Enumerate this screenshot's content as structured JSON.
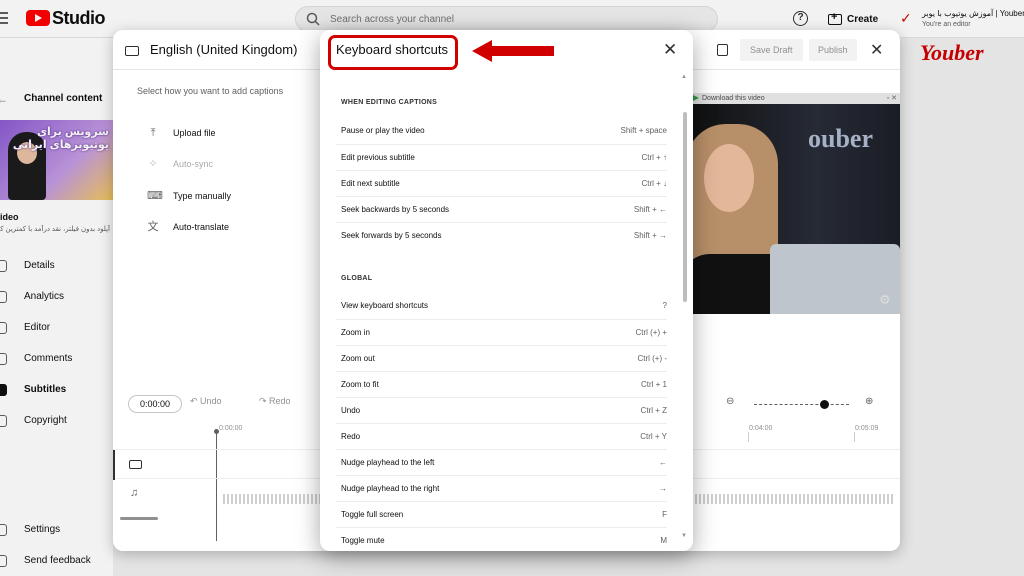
{
  "topbar": {
    "studio_label": "Studio",
    "search_placeholder": "Search across your channel",
    "help_label": "?",
    "create_label": "Create",
    "channel_name": "آموزش یوتیوب با یوبر | Youber",
    "channel_role": "You're an editor"
  },
  "sidebar": {
    "title": "Channel content",
    "thumbnail_text": "سرویس برای یوتیوبرهای ایرانی",
    "video_label": "ideo",
    "video_desc": "آپلود بدون فیلتر، نقد درآمد با کمترین کارمزد",
    "items": [
      {
        "label": "Details",
        "icon": "pencil-icon"
      },
      {
        "label": "Analytics",
        "icon": "chart-icon"
      },
      {
        "label": "Editor",
        "icon": "film-icon"
      },
      {
        "label": "Comments",
        "icon": "comment-icon"
      },
      {
        "label": "Subtitles",
        "icon": "subtitles-icon",
        "active": true
      },
      {
        "label": "Copyright",
        "icon": "copyright-icon"
      }
    ],
    "bottom_items": [
      {
        "label": "Settings",
        "icon": "gear-icon"
      },
      {
        "label": "Send feedback",
        "icon": "feedback-icon"
      }
    ]
  },
  "editor": {
    "language": "English (United Kingdom)",
    "save_draft": "Save Draft",
    "publish": "Publish",
    "prompt": "Select how you want to add captions",
    "options": [
      {
        "label": "Upload file",
        "icon": "upload-icon",
        "disabled": false
      },
      {
        "label": "Auto-sync",
        "icon": "sync-icon",
        "disabled": true
      },
      {
        "label": "Type manually",
        "icon": "keyboard-icon",
        "disabled": false
      },
      {
        "label": "Auto-translate",
        "icon": "translate-icon",
        "disabled": false
      }
    ],
    "download_bar": "Download this video",
    "video_logo": "ouber",
    "timecode": "0:00:00",
    "undo": "Undo",
    "redo": "Redo",
    "time_start": "0:00:00",
    "time_mid": "0:04:00",
    "time_end": "0:05:09",
    "brand_logo": "Youber"
  },
  "modal": {
    "title": "Keyboard shortcuts",
    "sections": [
      {
        "header": "WHEN EDITING CAPTIONS",
        "rows": [
          {
            "label": "Pause or play the video",
            "keys": "Shift + space"
          },
          {
            "label": "Edit previous subtitle",
            "keys": "Ctrl + ↑"
          },
          {
            "label": "Edit next subtitle",
            "keys": "Ctrl + ↓"
          },
          {
            "label": "Seek backwards by 5 seconds",
            "keys": "Shift + ←"
          },
          {
            "label": "Seek forwards by 5 seconds",
            "keys": "Shift + →"
          }
        ]
      },
      {
        "header": "GLOBAL",
        "rows": [
          {
            "label": "View keyboard shortcuts",
            "keys": "?"
          },
          {
            "label": "Zoom in",
            "keys": "Ctrl (+) +"
          },
          {
            "label": "Zoom out",
            "keys": "Ctrl (+) -"
          },
          {
            "label": "Zoom to fit",
            "keys": "Ctrl + 1"
          },
          {
            "label": "Undo",
            "keys": "Ctrl + Z"
          },
          {
            "label": "Redo",
            "keys": "Ctrl + Y"
          },
          {
            "label": "Nudge playhead to the left",
            "keys": "←"
          },
          {
            "label": "Nudge playhead to the right",
            "keys": "→"
          },
          {
            "label": "Toggle full screen",
            "keys": "F"
          },
          {
            "label": "Toggle mute",
            "keys": "M"
          }
        ]
      }
    ]
  },
  "colors": {
    "highlight_red": "#d00000",
    "youtube_red": "#ff0000"
  }
}
